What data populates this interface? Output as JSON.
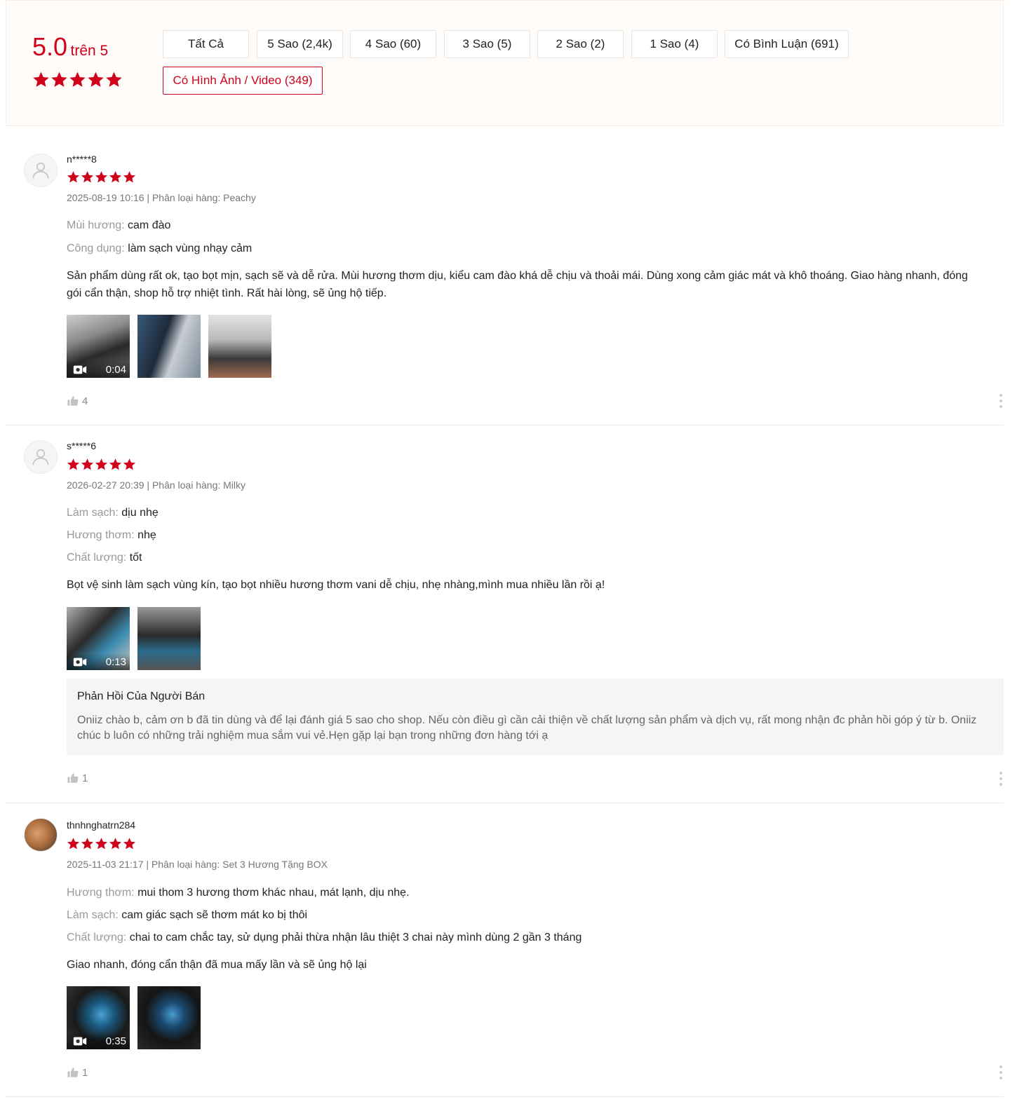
{
  "summary": {
    "score": "5.0",
    "score_suffix": "trên 5",
    "filters": [
      "Tất Cả",
      "5 Sao (2,4k)",
      "4 Sao (60)",
      "3 Sao (5)",
      "2 Sao (2)",
      "1 Sao (4)",
      "Có Bình Luận (691)",
      "Có Hình Ảnh / Video (349)"
    ],
    "active_filter_index": 7,
    "accent_color": "#d0011b"
  },
  "reviews": [
    {
      "username": "n*****8",
      "rating": 5,
      "meta": "2025-08-19 10:16 | Phân loại hàng: Peachy",
      "attributes": [
        {
          "key": "Mùi hương:",
          "value": "cam đào"
        },
        {
          "key": "Công dụng:",
          "value": "làm sạch vùng nhạy cảm"
        }
      ],
      "body": "Sản phẩm dùng rất ok, tạo bọt mịn, sạch sẽ và dễ rửa. Mùi hương thơm dịu, kiểu cam đào khá dễ chịu và thoải mái. Dùng xong cảm giác mát và khô thoáng. Giao hàng nhanh, đóng gói cẩn thận, shop hỗ trợ nhiệt tình. Rất hài lòng, sẽ ủng hộ tiếp.",
      "video_duration": "0:04",
      "likes": "4"
    },
    {
      "username": "s*****6",
      "rating": 5,
      "meta": "2026-02-27 20:39 | Phân loại hàng: Milky",
      "attributes": [
        {
          "key": "Làm sạch:",
          "value": "dịu nhẹ"
        },
        {
          "key": "Hương thơm:",
          "value": "nhẹ"
        },
        {
          "key": "Chất lượng:",
          "value": "tốt"
        }
      ],
      "body": "Bọt vệ sinh làm sạch vùng kín, tạo bọt nhiều hương thơm vani dễ chịu, nhẹ nhàng,mình mua nhiều lần rồi ạ!",
      "video_duration": "0:13",
      "seller_reply_title": "Phản Hồi Của Người Bán",
      "seller_reply": "Oniiz chào b, cảm ơn b đã tin dùng và để lại đánh giá 5 sao cho shop. Nếu còn điều gì cần cải thiện về chất lượng sản phẩm và dịch vụ, rất mong nhận đc phản hồi góp ý từ b. Oniiz chúc b luôn có những trải nghiệm mua sắm vui vẻ.Hẹn gặp lại bạn trong những đơn hàng tới ạ",
      "likes": "1"
    },
    {
      "username": "thnhnghatrn284",
      "rating": 5,
      "meta": "2025-11-03 21:17 | Phân loại hàng: Set 3 Hương Tặng BOX",
      "attributes": [
        {
          "key": "Hương thơm:",
          "value": "mui thom 3 hương thơm khác nhau, mát lạnh, dịu nhẹ."
        },
        {
          "key": "Làm sạch:",
          "value": "cam giác sạch sẽ thơm mát ko bị thôi"
        },
        {
          "key": "Chất lượng:",
          "value": "chai to cam chắc tay, sử dụng phải thừa nhận lâu thiệt 3 chai này mình dùng 2 gần 3 tháng"
        }
      ],
      "body": "Giao nhanh, đóng cẩn thận đã mua mấy lần và sẽ ủng hộ lại",
      "video_duration": "0:35",
      "likes": "1"
    }
  ]
}
